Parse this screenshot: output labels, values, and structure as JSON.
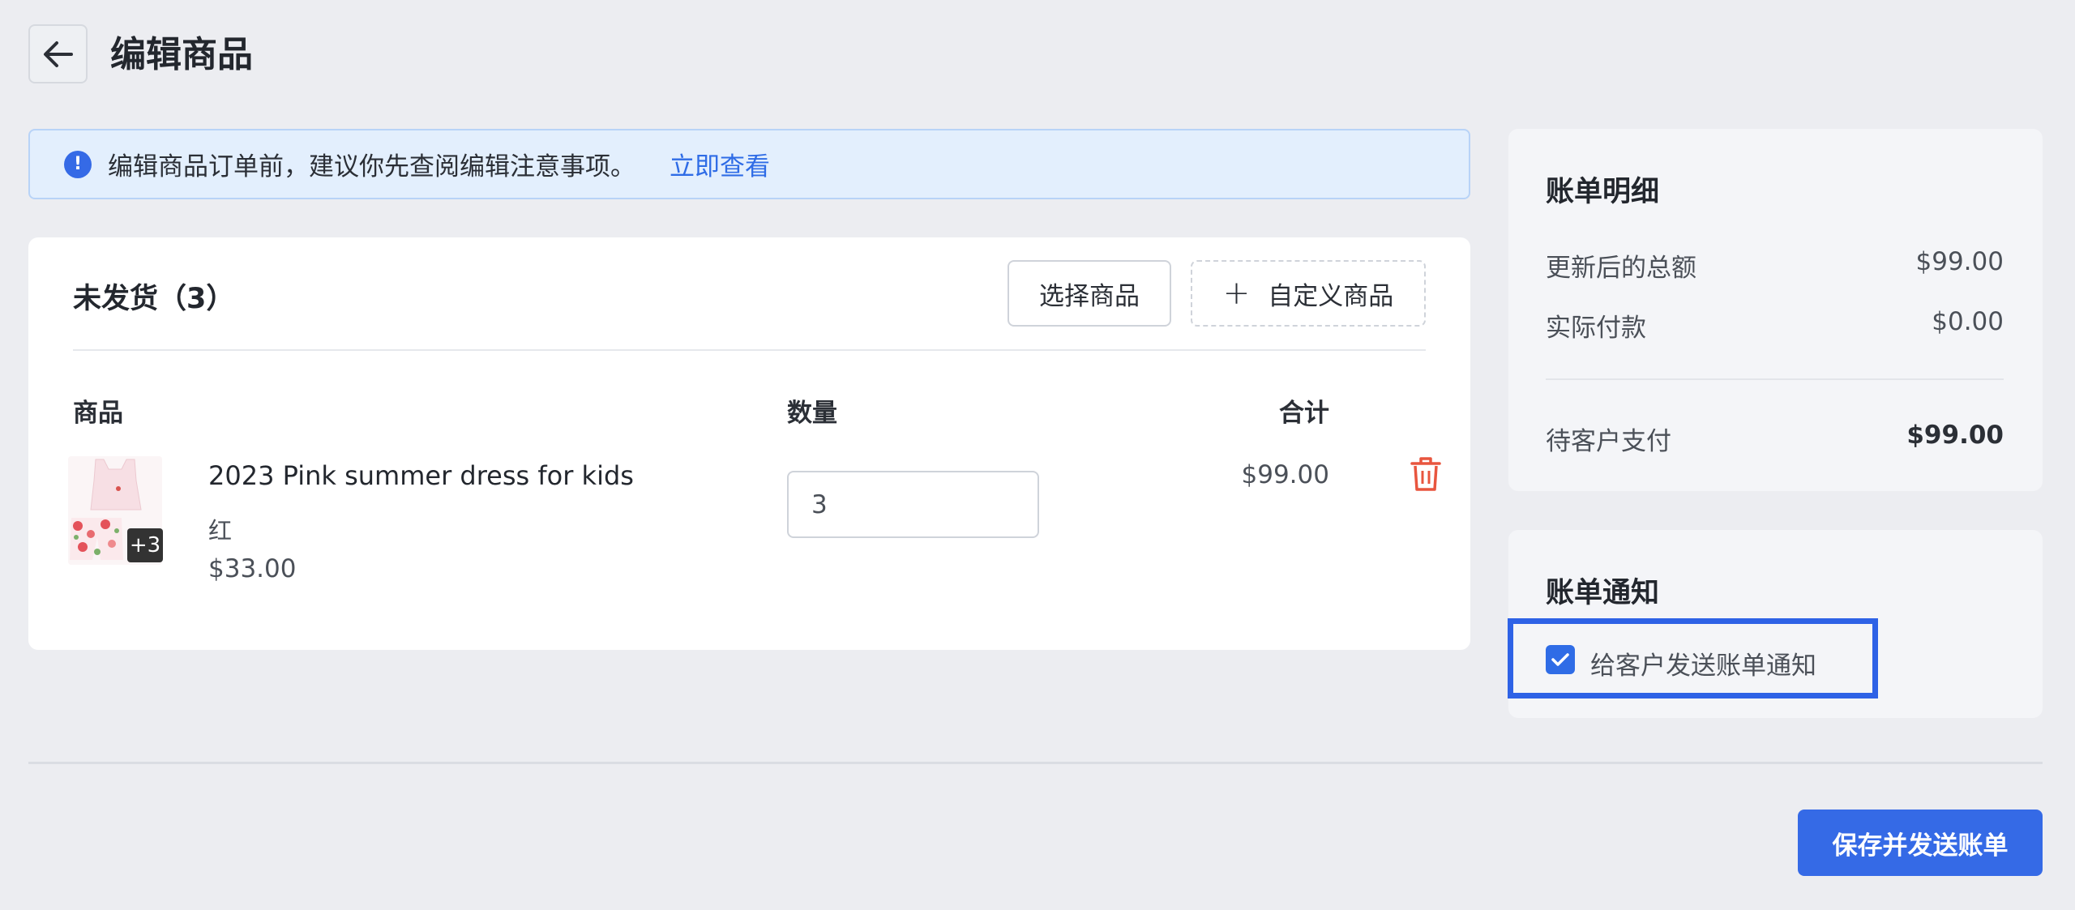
{
  "header": {
    "title": "编辑商品"
  },
  "alert": {
    "text": "编辑商品订单前，建议你先查阅编辑注意事项。",
    "link": "立即查看",
    "icon": "info-icon"
  },
  "unshipped": {
    "title": "未发货（3）",
    "select_button": "选择商品",
    "custom_button": "自定义商品",
    "columns": {
      "product": "商品",
      "quantity": "数量",
      "total": "合计"
    },
    "items": [
      {
        "name": "2023 Pink summer dress for kids",
        "variant": "红",
        "price": "$33.00",
        "quantity": "3",
        "total": "$99.00",
        "image_badge": "+3"
      }
    ]
  },
  "bill": {
    "title": "账单明细",
    "rows": [
      {
        "label": "更新后的总额",
        "value": "$99.00"
      },
      {
        "label": "实际付款",
        "value": "$0.00"
      }
    ],
    "due_label": "待客户支付",
    "due_value": "$99.00"
  },
  "notify": {
    "title": "账单通知",
    "checkbox_label": "给客户发送账单通知",
    "checked": true
  },
  "footer": {
    "save_button": "保存并发送账单"
  },
  "colors": {
    "accent": "#356ae6",
    "danger": "#e8553e",
    "background": "#ecedf1"
  }
}
